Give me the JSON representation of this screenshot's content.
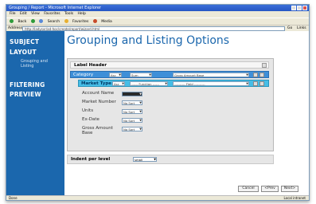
{
  "browser": {
    "title": "Grouping / Report - Microsoft Internet Explorer",
    "menu": [
      "File",
      "Edit",
      "View",
      "Favorites",
      "Tools",
      "Help"
    ],
    "toolbar": [
      "Back",
      "Search",
      "Favorites",
      "Media"
    ],
    "address_label": "Address",
    "address_value": "http://ladysvr/ad-hoc/create/report/wizard.html",
    "go_label": "Go",
    "links_label": "Links",
    "status_left": "Done",
    "status_right": "Local intranet"
  },
  "sidebar": {
    "items": [
      {
        "label": "SUBJECT"
      },
      {
        "label": "LAYOUT"
      },
      {
        "label": "FILTERING"
      },
      {
        "label": "PREVIEW"
      }
    ],
    "sub_item": "Grouping and Listing"
  },
  "page": {
    "title": "Grouping and Listing Options"
  },
  "panel": {
    "header": "Label Header",
    "category_row": {
      "label": "Category",
      "select_1": "Asc",
      "select_2": "Sum",
      "select_3": "Gross Amount Base"
    },
    "market_row": {
      "label": "Market Type",
      "select_1": "Asc",
      "select_2": "------ Function ------",
      "select_3": "---------- Field ----------"
    },
    "fields": [
      {
        "label": "Account Name",
        "value": "",
        "dark": true
      },
      {
        "label": "Market Number",
        "value": "No Sort"
      },
      {
        "label": "Units",
        "value": "No Sort"
      },
      {
        "label": "Ex-Date",
        "value": "No Sort"
      },
      {
        "label": "Gross Amount Base",
        "value": "No Sort"
      }
    ]
  },
  "indent": {
    "label": "Indent per level",
    "value": "small"
  },
  "buttons": {
    "cancel": "Cancel",
    "prev": "<Prev",
    "next": "Next>"
  },
  "colors": {
    "sidebar_bg": "#1b67ad",
    "title_color": "#1b67ad",
    "category_row": "#3f8fd8",
    "market_row": "#46bde6"
  }
}
